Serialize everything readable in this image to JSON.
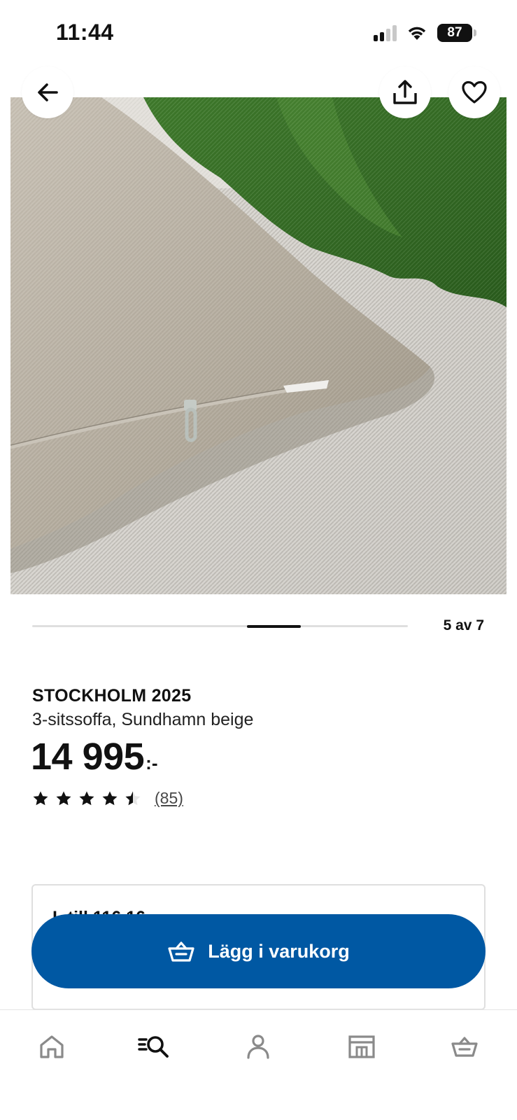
{
  "status_bar": {
    "time": "11:44",
    "battery": "87",
    "icons": [
      "signal-icon",
      "wifi-icon",
      "battery-icon"
    ]
  },
  "header": {
    "back_icon": "arrow-left-icon",
    "share_icon": "share-icon",
    "favorite_icon": "heart-icon"
  },
  "carousel": {
    "counter": "5 av 7",
    "current": 5,
    "total": 7
  },
  "product": {
    "name": "STOCKHOLM 2025",
    "description": "3-sitssoffa, Sundhamn beige",
    "price": "14 995",
    "price_suffix": ":-",
    "rating": 4.5,
    "review_count": "(85)"
  },
  "info_card": {
    "text": "L         till 116.16"
  },
  "cta": {
    "label": "Lägg i varukorg",
    "icon": "basket-icon",
    "color": "#0058a3"
  },
  "bottom_nav": {
    "items": [
      {
        "icon": "home-icon",
        "active": false
      },
      {
        "icon": "search-icon",
        "active": true
      },
      {
        "icon": "profile-icon",
        "active": false
      },
      {
        "icon": "store-icon",
        "active": false
      },
      {
        "icon": "cart-icon",
        "active": false
      }
    ]
  }
}
